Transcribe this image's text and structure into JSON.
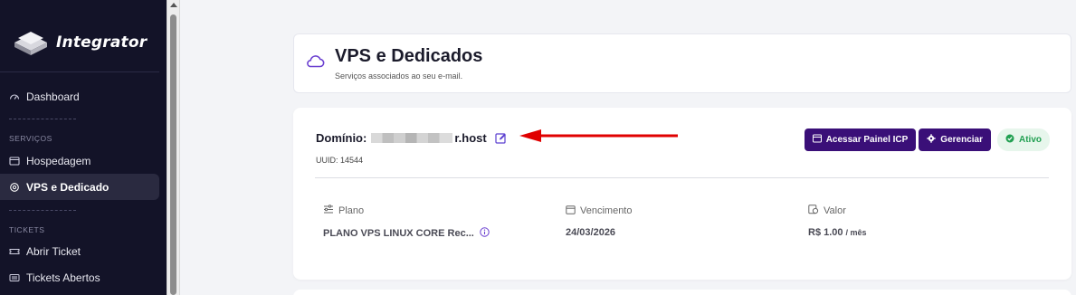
{
  "sidebar": {
    "brand": "Integrator",
    "items": [
      {
        "label": "Dashboard"
      },
      {
        "label": "Hospedagem"
      },
      {
        "label": "VPS e Dedicado"
      },
      {
        "label": "Abrir Ticket"
      },
      {
        "label": "Tickets Abertos"
      }
    ],
    "sections": [
      "SERVIÇOS",
      "TICKETS"
    ],
    "active_item": "VPS e Dedicado"
  },
  "header": {
    "title": "VPS e Dedicados",
    "subtitle": "Serviços associados ao seu e-mail."
  },
  "service": {
    "domain_label": "Domínio:",
    "domain_visible_suffix": "r.host",
    "uuid": "UUID: 14544",
    "buttons": {
      "panel": "Acessar Painel ICP",
      "manage": "Gerenciar"
    },
    "status": "Ativo",
    "plan": {
      "label": "Plano",
      "value": "PLANO VPS LINUX CORE Rec..."
    },
    "due": {
      "label": "Vencimento",
      "value": "24/03/2026"
    },
    "price": {
      "label": "Valor",
      "value": "R$ 1.00",
      "period": "/ mês"
    }
  },
  "colors": {
    "sidebar_bg": "#131328",
    "accent": "#3a0f78",
    "status_green": "#22a052",
    "arrow_red": "#e00000"
  }
}
